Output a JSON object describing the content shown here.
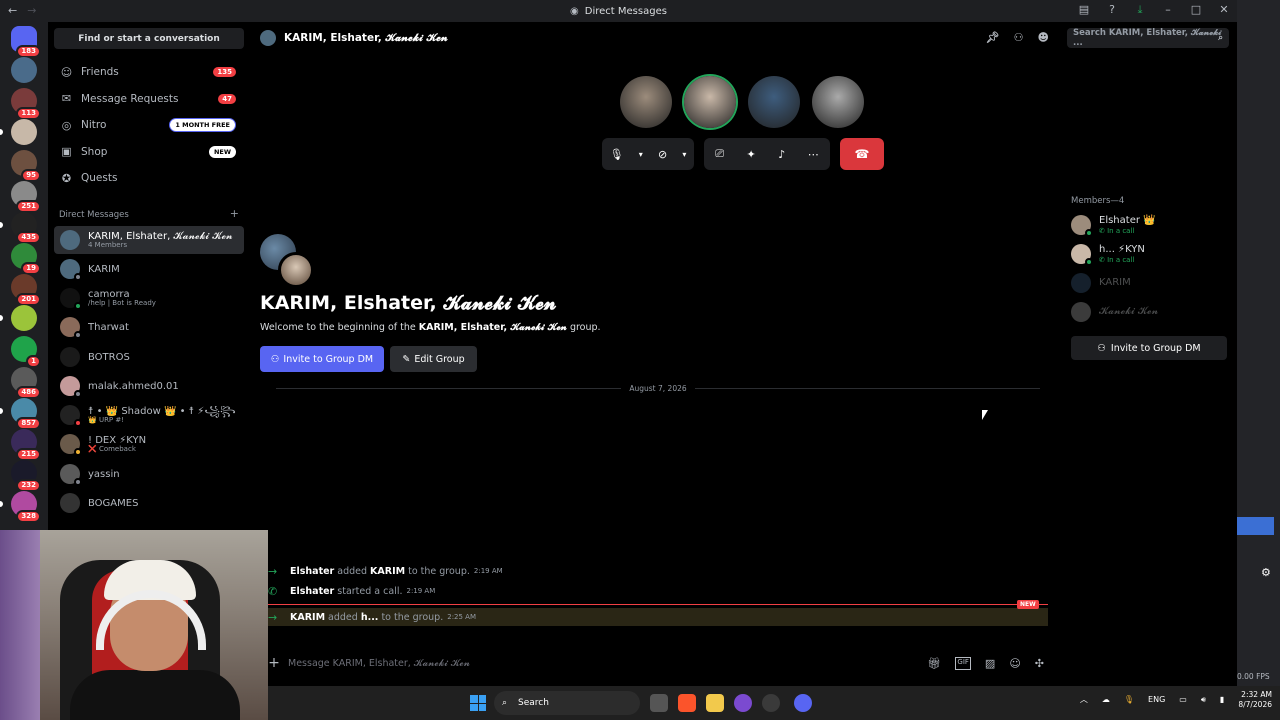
{
  "window": {
    "title": "Direct Messages"
  },
  "servers": [
    {
      "badge": "183",
      "color": "#5865f2"
    },
    {
      "badge": "",
      "color": "#4a6b8a"
    },
    {
      "badge": "113",
      "color": "#7a3b3b"
    },
    {
      "badge": "",
      "color": "#c7b8a8"
    },
    {
      "badge": "95",
      "color": "#6d5040"
    },
    {
      "badge": "251",
      "color": "#8a8a8a"
    },
    {
      "badge": "435",
      "color": "#222"
    },
    {
      "badge": "19",
      "color": "#2f8a3a"
    },
    {
      "badge": "201",
      "color": "#6a3a2a"
    },
    {
      "badge": "",
      "color": "#9bc43a"
    },
    {
      "badge": "1",
      "color": "#1fa34a"
    },
    {
      "badge": "486",
      "color": "#5a5a5a"
    },
    {
      "badge": "857",
      "color": "#4a8aa8"
    },
    {
      "badge": "215",
      "color": "#3a2a5a"
    },
    {
      "badge": "232",
      "color": "#1a1a2a"
    },
    {
      "badge": "328",
      "color": "#b04aa0"
    }
  ],
  "sidebar": {
    "search_label": "Find or start a conversation",
    "nav": [
      {
        "label": "Friends",
        "icon": "friends-icon",
        "glyph": "☺",
        "count": "135"
      },
      {
        "label": "Message Requests",
        "icon": "mail-icon",
        "glyph": "✉",
        "count": "47"
      },
      {
        "label": "Nitro",
        "icon": "nitro-icon",
        "glyph": "◎",
        "tag": "1 MONTH FREE"
      },
      {
        "label": "Shop",
        "icon": "shop-icon",
        "glyph": "▣",
        "tag": "NEW"
      },
      {
        "label": "Quests",
        "icon": "quests-icon",
        "glyph": "✪"
      }
    ],
    "dm_header": "Direct Messages",
    "dm_add": "+",
    "dms": [
      {
        "name": "KARIM, Elshater, 𝓚𝓪𝓷𝓮𝓴𝓲 𝓚𝓮𝓷",
        "sub": "4 Members",
        "color": "#4e6a7e",
        "status": "",
        "active": true
      },
      {
        "name": "KARIM",
        "sub": "",
        "color": "#4e6a7e",
        "status": "#80848e"
      },
      {
        "name": "camorra",
        "sub": "/help | Bot is Ready",
        "color": "#111",
        "status": "#23a55a"
      },
      {
        "name": "Tharwat",
        "sub": "",
        "color": "#8a6a5a",
        "status": "#80848e"
      },
      {
        "name": "BOTROS",
        "sub": "",
        "color": "#1a1a1a",
        "status": ""
      },
      {
        "name": "malak.ahmed0.01",
        "sub": "",
        "color": "#c49a9a",
        "status": "#80848e"
      },
      {
        "name": "☨ • 👑 Shadow 👑 • ☨ ⚡꧁꧂",
        "sub": "👑 URP #!",
        "color": "#222",
        "status": "#f23f43"
      },
      {
        "name": "! DEX ⚡KYN",
        "sub": "❌ Comeback",
        "color": "#6a5a4a",
        "status": "#f0b232"
      },
      {
        "name": "yassin",
        "sub": "",
        "color": "#5a5a5a",
        "status": "#80848e"
      },
      {
        "name": "BOGAMES",
        "sub": "",
        "color": "#333",
        "status": ""
      }
    ]
  },
  "chat": {
    "header_title": "KARIM, Elshater, 𝓚𝓪𝓷𝓮𝓴𝓲 𝓚𝓮𝓷",
    "search_placeholder": "Search KARIM, Elshater, 𝓚𝓪𝓷𝓮𝓴𝓲 ...",
    "call_avatars": [
      "#9c8c7c",
      "#c9b8a8",
      "#3e5d7e",
      "#aaaaaa"
    ],
    "intro_title": "KARIM, Elshater, 𝓚𝓪𝓷𝓮𝓴𝓲 𝓚𝓮𝓷",
    "intro_prefix": "Welcome to the beginning of the ",
    "intro_group": "KARIM, Elshater, 𝓚𝓪𝓷𝓮𝓴𝓲 𝓚𝓮𝓷",
    "intro_suffix": " group.",
    "invite_label": "Invite to Group DM",
    "edit_label": "Edit Group",
    "date": "August 7, 2026",
    "messages": [
      {
        "actor": "Elshater",
        "action": " added ",
        "target": "KARIM",
        "rest": " to the group.",
        "time": "2:19 AM",
        "arrow": "→"
      },
      {
        "actor": "Elshater",
        "action": " started a call.",
        "target": "",
        "rest": "",
        "time": "2:19 AM",
        "arrow": "✆"
      },
      {
        "actor": "KARIM",
        "action": " added ",
        "target": "h...",
        "rest": " to the group.",
        "time": "2:25 AM",
        "arrow": "→"
      }
    ],
    "new_tag": "NEW",
    "composer_placeholder": "Message KARIM, Elshater, 𝓚𝓪𝓷𝓮𝓴𝓲 𝓚𝓮𝓷"
  },
  "members": {
    "header": "Members—4",
    "list": [
      {
        "name": "Elshater 👑",
        "sub": "✆ In a call",
        "color": "#9c8c7c",
        "off": false
      },
      {
        "name": "h... ⚡KYN",
        "sub": "✆ In a call",
        "color": "#c9b8a8",
        "off": false
      },
      {
        "name": "KARIM",
        "sub": "",
        "color": "#3e5d7e",
        "off": true
      },
      {
        "name": "𝓚𝓪𝓷𝓮𝓴𝓲 𝓚𝓮𝓷",
        "sub": "",
        "color": "#aaaaaa",
        "off": true
      }
    ],
    "invite_label": "Invite to Group DM"
  },
  "taskbar": {
    "search": "Search",
    "lang": "ENG",
    "time": "2:32 AM",
    "date": "8/7/2026"
  },
  "right_edge": {
    "fps": "0.00 FPS"
  }
}
